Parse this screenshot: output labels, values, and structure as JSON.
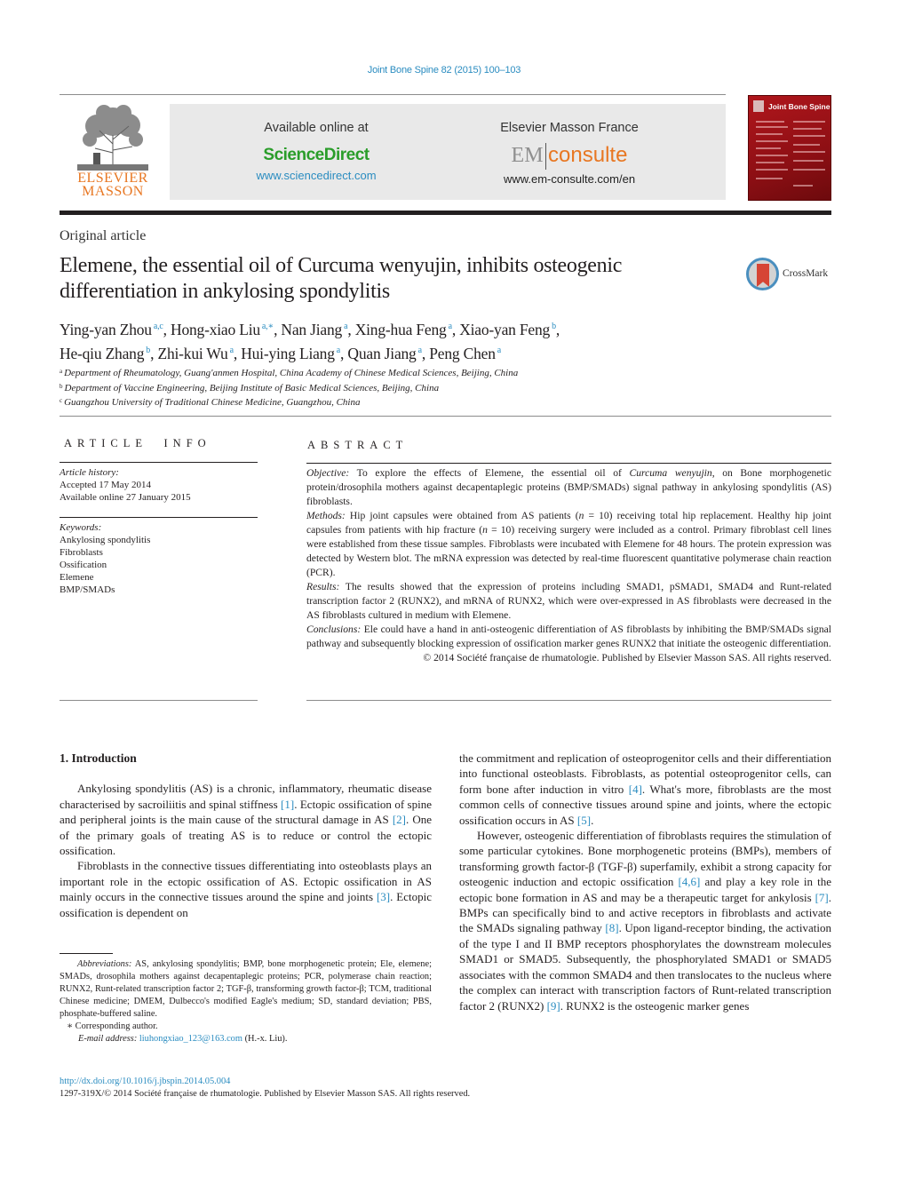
{
  "header": {
    "journal_ref": "Joint Bone Spine 82 (2015) 100–103",
    "publisher_logo_text": [
      "ELSEVIER",
      "MASSON"
    ],
    "sciencedirect": {
      "heading": "Available online at",
      "name": "ScienceDirect",
      "url": "www.sciencedirect.com"
    },
    "emconsulte": {
      "heading": "Elsevier Masson France",
      "logo_em": "EM",
      "logo_consulte": "consulte",
      "url": "www.em-consulte.com/en"
    },
    "cover": {
      "title": "Joint Bone Spine"
    },
    "colors": {
      "link_blue": "#2a8cc0",
      "sciencedirect_green": "#2a9d2a",
      "elsevier_orange": "#e87722",
      "cover_red": "#b0161c"
    }
  },
  "article": {
    "type": "Original article",
    "title": "Elemene, the essential oil of Curcuma wenyujin, inhibits osteogenic differentiation in ankylosing spondylitis",
    "crossmark_label": "CrossMark",
    "authors": [
      {
        "name": "Ying-yan Zhou",
        "aff": "a,c"
      },
      {
        "name": "Hong-xiao Liu",
        "aff": "a,∗"
      },
      {
        "name": "Nan Jiang",
        "aff": "a"
      },
      {
        "name": "Xing-hua Feng",
        "aff": "a"
      },
      {
        "name": "Xiao-yan Feng",
        "aff": "b"
      },
      {
        "name": "He-qiu Zhang",
        "aff": "b"
      },
      {
        "name": "Zhi-kui Wu",
        "aff": "a"
      },
      {
        "name": "Hui-ying Liang",
        "aff": "a"
      },
      {
        "name": "Quan Jiang",
        "aff": "a"
      },
      {
        "name": "Peng Chen",
        "aff": "a"
      }
    ],
    "affiliations": [
      {
        "key": "a",
        "text": "Department of Rheumatology, Guang'anmen Hospital, China Academy of Chinese Medical Sciences, Beijing, China"
      },
      {
        "key": "b",
        "text": "Department of Vaccine Engineering, Beijing Institute of Basic Medical Sciences, Beijing, China"
      },
      {
        "key": "c",
        "text": "Guangzhou University of Traditional Chinese Medicine, Guangzhou, China"
      }
    ]
  },
  "article_info": {
    "heading": "ARTICLE INFO",
    "history_label": "Article history:",
    "history": [
      "Accepted 17 May 2014",
      "Available online 27 January 2015"
    ],
    "keywords_label": "Keywords:",
    "keywords": [
      "Ankylosing spondylitis",
      "Fibroblasts",
      "Ossification",
      "Elemene",
      "BMP/SMADs"
    ]
  },
  "abstract": {
    "heading": "ABSTRACT",
    "objective_label": "Objective:",
    "objective_pre": " To explore the effects of Elemene, the essential oil of ",
    "objective_species": "Curcuma wenyujin",
    "objective_post": ", on Bone morpho­genetic protein/drosophila mothers against decapentaplegic proteins (BMP/SMADs) signal pathway in ankylosing spondylitis (AS) fibroblasts.",
    "methods_label": "Methods:",
    "methods_1": " Hip joint capsules were obtained from AS patients (",
    "methods_n1": "n",
    "methods_2": " = 10) receiving total hip replacement. Healthy hip joint capsules from patients with hip fracture (",
    "methods_n2": "n",
    "methods_3": " = 10) receiving surgery were included as a control. Primary fibroblast cell lines were established from these tissue samples. Fibroblasts were incubated with Elemene for 48 hours. The protein expression was detected by Western blot. The mRNA expression was detected by real-time fluorescent quantitative polymerase chain reaction (PCR).",
    "results_label": "Results:",
    "results_text": " The results showed that the expression of proteins including SMAD1, pSMAD1, SMAD4 and Runt-related transcription factor 2 (RUNX2), and mRNA of RUNX2, which were over-expressed in AS fibroblasts were decreased in the AS fibroblasts cultured in medium with Elemene.",
    "conclusions_label": "Conclusions:",
    "conclusions_text": " Ele could have a hand in anti-osteogenic differentiation of AS fibroblasts by inhibiting the BMP/SMADs signal pathway and subsequently blocking expression of ossification marker genes RUNX2 that initiate the osteogenic differentiation.",
    "copyright": "© 2014 Société française de rhumatologie. Published by Elsevier Masson SAS. All rights reserved."
  },
  "body": {
    "section_heading": "1.  Introduction",
    "left_p1": [
      {
        "t": "Ankylosing spondylitis (AS) is a chronic, inflammatory, rheumatic disease characterised by sacroiliitis and spinal stiffness "
      },
      {
        "ref": "[1]"
      },
      {
        "t": ". Ectopic ossification of spine and peripheral joints is the main cause of the structural damage in AS "
      },
      {
        "ref": "[2]"
      },
      {
        "t": ". One of the primary goals of treating AS is to reduce or control the ectopic ossification."
      }
    ],
    "left_p2": [
      {
        "t": "Fibroblasts in the connective tissues differentiating into osteoblasts plays an important role in the ectopic ossification of AS. Ectopic ossification in AS mainly occurs in the connective tissues around the spine and joints "
      },
      {
        "ref": "[3]"
      },
      {
        "t": ". Ectopic ossification is dependent on"
      }
    ],
    "right_p1": [
      {
        "t": "the commitment and replication of osteoprogenitor cells and their differentiation into functional osteoblasts. Fibroblasts, as potential osteoprogenitor cells, can form bone after induction in vitro "
      },
      {
        "ref": "[4]"
      },
      {
        "t": ". What's more, fibroblasts are the most common cells of connec­tive tissues around spine and joints, where the ectopic ossification occurs in AS "
      },
      {
        "ref": "[5]"
      },
      {
        "t": "."
      }
    ],
    "right_p2": [
      {
        "t": "However, osteogenic differentiation of fibroblasts requires the stimulation of some particular cytokines. Bone morphogenetic pro­teins (BMPs), members of transforming growth factor-β (TGF-β) superfamily, exhibit a strong capacity for osteogenic induction and ectopic ossification "
      },
      {
        "ref": "[4,6]"
      },
      {
        "t": " and play a key role in the ectopic bone formation in AS and may be a therapeutic target for ankylosis "
      },
      {
        "ref": "[7]"
      },
      {
        "t": ". BMPs can specifically bind to and active receptors in fibroblasts and activate the SMADs signaling pathway "
      },
      {
        "ref": "[8]"
      },
      {
        "t": ". Upon ligand-receptor binding, the activation of the type I and II BMP receptors phosphory­lates the downstream molecules SMAD1 or SMAD5. Subsequently, the phosphorylated SMAD1 or SMAD5 associates with the common SMAD4 and then translocates to the nucleus where the complex can interact with transcription factors of Runt-related transcrip­tion factor 2 (RUNX2) "
      },
      {
        "ref": "[9]"
      },
      {
        "t": ". RUNX2 is the osteogenic marker genes"
      }
    ]
  },
  "footnotes": {
    "abbrev_label": "Abbreviations:",
    "abbrev_text": " AS, ankylosing spondylitis; BMP, bone morphogenetic protein; Ele, elemene; SMADs, drosophila mothers against decapentaplegic proteins; PCR, polymerase chain reaction; RUNX2, Runt-related transcription factor 2; TGF-β, transforming growth factor-β; TCM, traditional Chinese medicine; DMEM, Dul­becco's modified Eagle's medium; SD, standard deviation; PBS, phosphate-buffered saline.",
    "corresponding": "∗  Corresponding author.",
    "email_label": "E-mail address:",
    "email": "liuhongxiao_123@163.com",
    "email_suffix": " (H.-x. Liu)."
  },
  "footer": {
    "doi": "http://dx.doi.org/10.1016/j.jbspin.2014.05.004",
    "issn": "1297-319X/© 2014 Société française de rhumatologie. Published by Elsevier Masson SAS. All rights reserved."
  }
}
